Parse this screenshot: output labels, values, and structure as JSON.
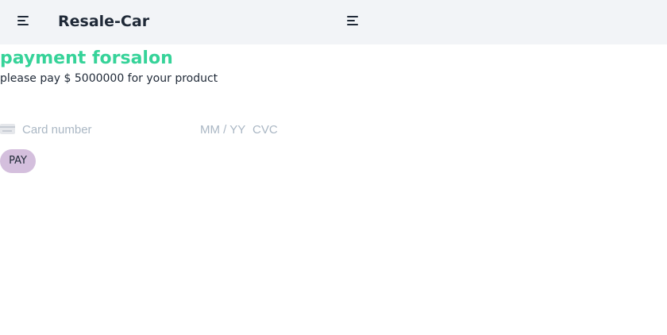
{
  "navbar": {
    "brand": "Resale-Car",
    "left_menu_icon": "menu-icon",
    "center_menu_icon": "menu-icon"
  },
  "payment": {
    "title": "payment forsalon",
    "subtitle": "please pay $ 5000000 for your product",
    "card_icon": "credit-card-icon",
    "card_number_placeholder": "Card number",
    "expiry_placeholder": "MM / YY",
    "cvc_placeholder": "CVC",
    "pay_label": "PAY"
  },
  "colors": {
    "title": "#36d399",
    "navbar_bg": "#f2f4f7",
    "pay_button_bg": "#d4bfdd",
    "placeholder": "#aab7c4"
  }
}
